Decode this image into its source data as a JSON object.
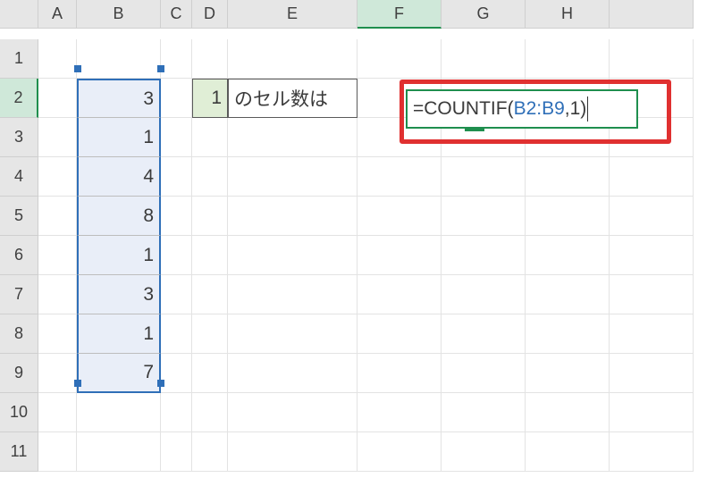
{
  "columns": [
    "A",
    "B",
    "C",
    "D",
    "E",
    "F",
    "G",
    "H"
  ],
  "rows": [
    "1",
    "2",
    "3",
    "4",
    "5",
    "6",
    "7",
    "8",
    "9",
    "10",
    "11"
  ],
  "active_col": "F",
  "active_row": "2",
  "range_B": {
    "values": [
      "3",
      "1",
      "4",
      "8",
      "1",
      "3",
      "1",
      "7"
    ]
  },
  "D2": "1",
  "E2": "のセル数は",
  "formula": {
    "prefix": "=COUNTIF(",
    "ref": "B2:B9",
    "suffix": ",1)"
  }
}
